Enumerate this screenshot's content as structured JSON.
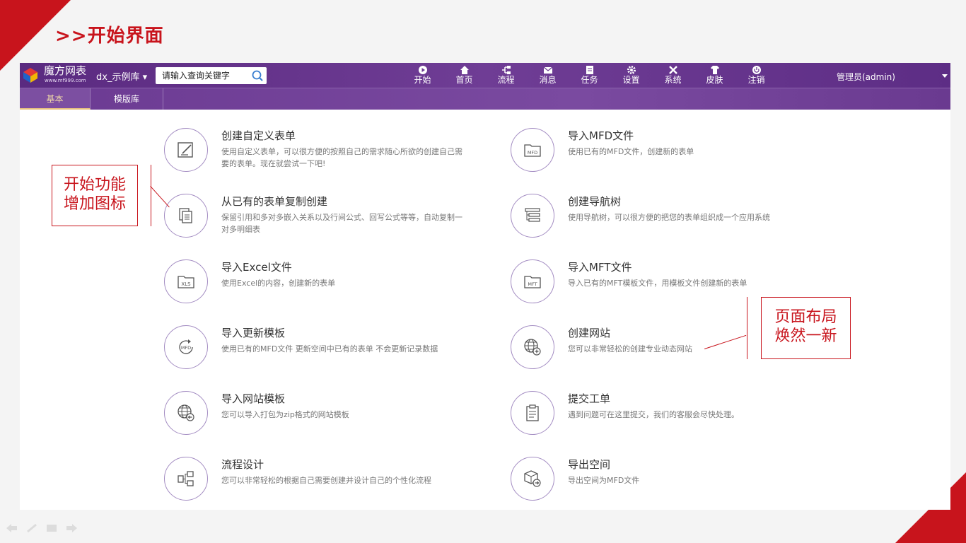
{
  "slide": {
    "title": ">>开始界面",
    "watermark": ""
  },
  "app": {
    "logo_text": "魔方网表",
    "logo_url": "www.mf999.com",
    "library": "dx_示例库 ▾",
    "search": {
      "placeholder": "请输入查询关键字"
    },
    "nav": [
      {
        "label": "开始",
        "icon": "play-icon"
      },
      {
        "label": "首页",
        "icon": "home-icon"
      },
      {
        "label": "流程",
        "icon": "flow-icon"
      },
      {
        "label": "消息",
        "icon": "mail-icon"
      },
      {
        "label": "任务",
        "icon": "task-icon"
      },
      {
        "label": "设置",
        "icon": "gear-icon"
      },
      {
        "label": "系统",
        "icon": "tools-icon"
      },
      {
        "label": "皮肤",
        "icon": "shirt-icon"
      },
      {
        "label": "注销",
        "icon": "power-icon"
      }
    ],
    "user": "管理员(admin)",
    "tabs": [
      {
        "label": "基本"
      },
      {
        "label": "模版库"
      }
    ],
    "accent": "#6b3a92"
  },
  "features": [
    {
      "title": "创建自定义表单",
      "desc": "使用自定义表单，可以很方便的按照自己的需求随心所欲的创建自己需要的表单。现在就尝试一下吧!",
      "icon": "edit-form-icon"
    },
    {
      "title": "导入MFD文件",
      "desc": "使用已有的MFD文件，创建新的表单",
      "icon": "mfd-folder-icon"
    },
    {
      "title": "从已有的表单复制创建",
      "desc": "保留引用和多对多嵌入关系以及行间公式、回写公式等等，自动复制一对多明细表",
      "icon": "copy-icon"
    },
    {
      "title": "创建导航树",
      "desc": "使用导航树，可以很方便的把您的表单组织成一个应用系统",
      "icon": "nav-tree-icon"
    },
    {
      "title": "导入Excel文件",
      "desc": "使用Excel的内容，创建新的表单",
      "icon": "xls-folder-icon"
    },
    {
      "title": "导入MFT文件",
      "desc": "导入已有的MFT模板文件，用模板文件创建新的表单",
      "icon": "mft-folder-icon"
    },
    {
      "title": "导入更新模板",
      "desc": "使用已有的MFD文件 更新空间中已有的表单 不会更新记录数据",
      "icon": "mfd-refresh-icon"
    },
    {
      "title": "创建网站",
      "desc": "您可以非常轻松的创建专业动态网站",
      "icon": "globe-add-icon"
    },
    {
      "title": "导入网站模板",
      "desc": "您可以导入打包为zip格式的网站模板",
      "icon": "globe-import-icon"
    },
    {
      "title": "提交工单",
      "desc": "遇到问题可在这里提交，我们的客服会尽快处理。",
      "icon": "clipboard-icon"
    },
    {
      "title": "流程设计",
      "desc": "您可以非常轻松的根据自己需要创建并设计自己的个性化流程",
      "icon": "flowchart-icon"
    },
    {
      "title": "导出空间",
      "desc": "导出空间为MFD文件",
      "icon": "box-export-icon"
    }
  ],
  "callouts": {
    "left": {
      "line1": "开始功能",
      "line2": "增加图标"
    },
    "right": {
      "line1": "页面布局",
      "line2": "焕然一新"
    }
  }
}
